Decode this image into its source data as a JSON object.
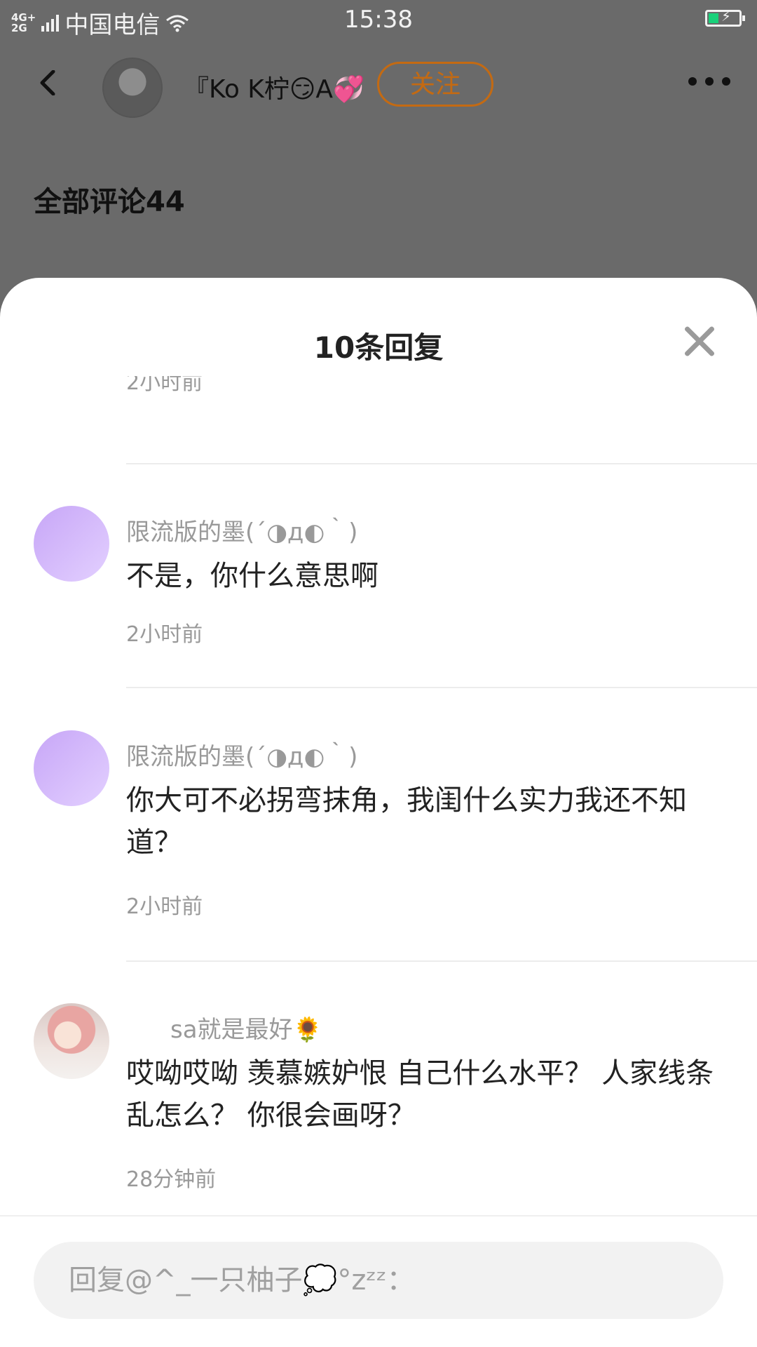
{
  "status_bar": {
    "network": "4G+\n2G",
    "carrier": "中国电信",
    "time": "15:38"
  },
  "header": {
    "username": "『Ko K柠😏A💞",
    "follow_label": "关注"
  },
  "comments_heading": "全部评论44",
  "sheet": {
    "title": "10条回复",
    "previous_time": "2小时前",
    "replies": [
      {
        "name": "限流版的墨(´◑д◐｀)",
        "text": "不是，你什么意思啊",
        "time": "2小时前",
        "avatar": "purple"
      },
      {
        "name": "限流版的墨(´◑д◐｀)",
        "text": "你大可不必拐弯抹角，我闺什么实力我还不知道？",
        "time": "2小时前",
        "avatar": "purple"
      },
      {
        "name": "sa就是最好🌻",
        "text": "哎呦哎呦 羡慕嫉妒恨 自己什么水平？ 人家线条乱怎么？ 你很会画呀？",
        "time": "28分钟前",
        "avatar": "anime-girl"
      }
    ]
  },
  "reply_input": {
    "placeholder": "回复@^_一只柚子💭°zᶻᶻ："
  },
  "colors": {
    "follow": "#c46a12",
    "dim_overlay": "#6a6a6a",
    "avatar_purple": "#d3bcfb"
  }
}
